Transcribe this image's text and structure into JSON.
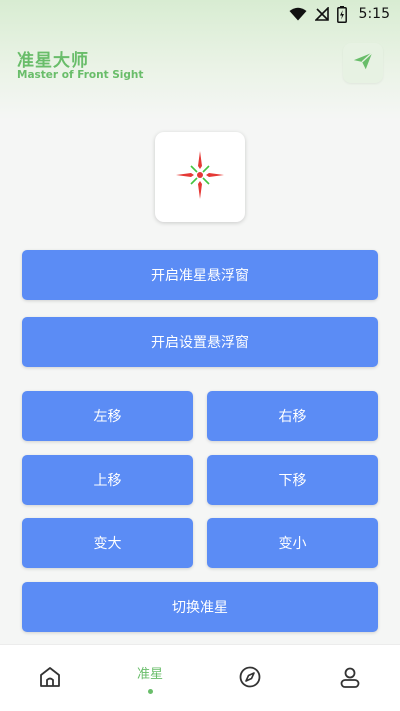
{
  "status": {
    "time": "5:15"
  },
  "header": {
    "title": "准星大师",
    "subtitle": "Master of Front Sight",
    "share_icon": "send-icon"
  },
  "preview": {
    "icon": "crosshair-icon",
    "accent_colors": [
      "#e53935",
      "#43c43f"
    ]
  },
  "buttons": {
    "open_crosshair": "开启准星悬浮窗",
    "open_settings": "开启设置悬浮窗",
    "move_left": "左移",
    "move_right": "右移",
    "move_up": "上移",
    "move_down": "下移",
    "enlarge": "变大",
    "shrink": "变小",
    "switch_crosshair": "切换准星"
  },
  "bottom_nav": {
    "items": [
      {
        "icon": "home-icon",
        "label": ""
      },
      {
        "icon": "",
        "label": "准星",
        "active": true
      },
      {
        "icon": "compass-icon",
        "label": ""
      },
      {
        "icon": "profile-icon",
        "label": ""
      }
    ]
  },
  "colors": {
    "accent_green": "#69bd6a",
    "button_blue": "#5b8cf5",
    "background": "#f5f6f5"
  }
}
